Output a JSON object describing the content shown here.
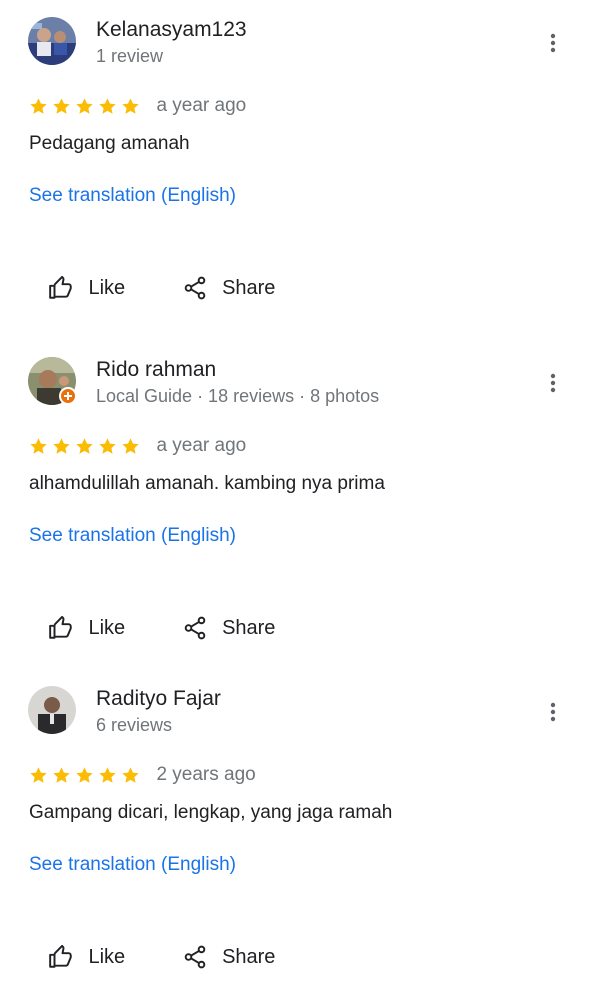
{
  "colors": {
    "star": "#fbbc04",
    "link": "#1a73e8",
    "secondary_text": "#70757a",
    "primary_text": "#202124",
    "local_guide_badge": "#e8710a"
  },
  "icons": {
    "star": "star-icon",
    "more": "more-vert-icon",
    "like": "thumb-up-outline-icon",
    "share": "share-icon",
    "local_guide": "local-guide-badge-icon"
  },
  "reviews": [
    {
      "name": "Kelanasyam123",
      "meta": "1 review",
      "rating": 5,
      "date": "a year ago",
      "text": "Pedagang amanah",
      "translate": "See translation (English)",
      "like": "Like",
      "share": "Share"
    },
    {
      "name": "Rido rahman",
      "meta": "Local Guide · 18 reviews · 8 photos",
      "local_guide": true,
      "rating": 5,
      "date": "a year ago",
      "text": "alhamdulillah amanah. kambing nya prima",
      "translate": "See translation (English)",
      "like": "Like",
      "share": "Share"
    },
    {
      "name": "Radityo Fajar",
      "meta": "6 reviews",
      "rating": 5,
      "date": "2 years ago",
      "text": "Gampang dicari, lengkap, yang jaga ramah",
      "translate": "See translation (English)",
      "like": "Like",
      "share": "Share"
    }
  ]
}
